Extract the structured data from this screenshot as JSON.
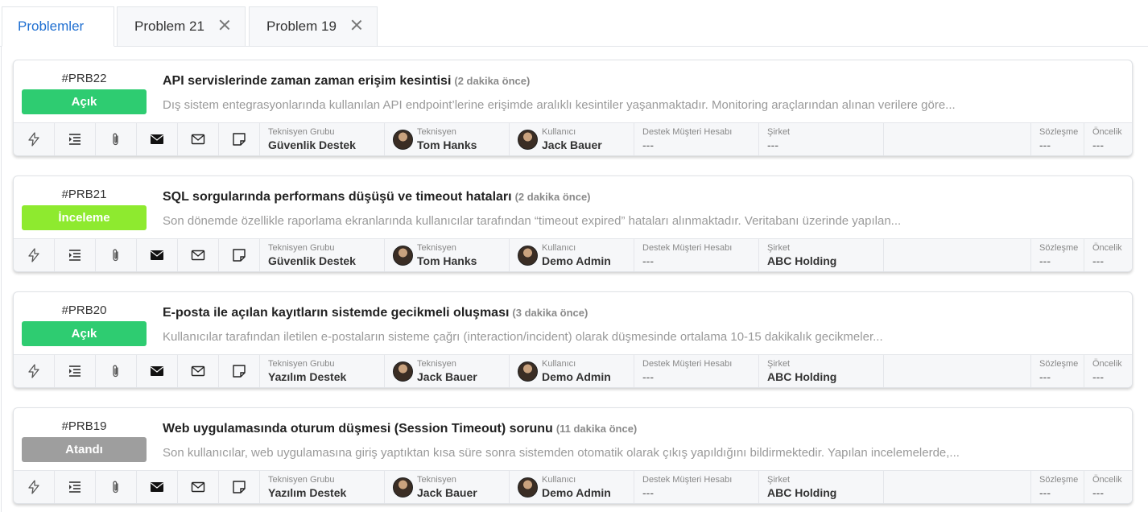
{
  "tabs": [
    {
      "label": "Problemler"
    },
    {
      "label": "Problem 21"
    },
    {
      "label": "Problem 19"
    }
  ],
  "field_labels": {
    "tech_group": "Teknisyen Grubu",
    "technician": "Teknisyen",
    "user": "Kullanıcı",
    "customer_account": "Destek Müşteri Hesabı",
    "company": "Şirket",
    "contract": "Sözleşme",
    "priority": "Öncelik"
  },
  "status_colors": {
    "Açık": "#2ecc71",
    "İnceleme": "#8eea2f",
    "Atandı": "#9e9e9e"
  },
  "footer_icons": [
    "bolt-icon",
    "list-indent-icon",
    "paperclip-icon",
    "envelope-filled-icon",
    "envelope-outline-icon",
    "note-icon"
  ],
  "problems": [
    {
      "code": "#PRB22",
      "status": "Açık",
      "title": "API servislerinde zaman zaman erişim kesintisi",
      "ago": "(2 dakika önce)",
      "description": "Dış sistem entegrasyonlarında kullanılan API endpoint’lerine erişimde aralıklı kesintiler yaşanmaktadır. Monitoring araçlarından alınan verilere göre...",
      "tech_group": "Güvenlik Destek",
      "technician": "Tom Hanks",
      "user": "Jack Bauer",
      "customer_account": "---",
      "company": "---",
      "contract": "---",
      "priority": "---"
    },
    {
      "code": "#PRB21",
      "status": "İnceleme",
      "title": "SQL sorgularında performans düşüşü ve timeout hataları",
      "ago": "(2 dakika önce)",
      "description": "Son dönemde özellikle raporlama ekranlarında kullanıcılar tarafından “timeout expired” hataları alınmaktadır. Veritabanı üzerinde yapılan...",
      "tech_group": "Güvenlik Destek",
      "technician": "Tom Hanks",
      "user": "Demo Admin",
      "customer_account": "---",
      "company": "ABC Holding",
      "contract": "---",
      "priority": "---"
    },
    {
      "code": "#PRB20",
      "status": "Açık",
      "title": "E-posta ile açılan kayıtların sistemde gecikmeli oluşması",
      "ago": "(3 dakika önce)",
      "description": "Kullanıcılar tarafından iletilen e-postaların sisteme çağrı (interaction/incident) olarak düşmesinde ortalama 10-15 dakikalık gecikmeler...",
      "tech_group": "Yazılım Destek",
      "technician": "Jack Bauer",
      "user": "Demo Admin",
      "customer_account": "---",
      "company": "ABC Holding",
      "contract": "---",
      "priority": "---"
    },
    {
      "code": "#PRB19",
      "status": "Atandı",
      "title": "Web uygulamasında oturum düşmesi (Session Timeout) sorunu",
      "ago": "(11 dakika önce)",
      "description": "Son kullanıcılar, web uygulamasına giriş yaptıktan kısa süre sonra sistemden otomatik olarak çıkış yapıldığını bildirmektedir. Yapılan incelemelerde,...",
      "tech_group": "Yazılım Destek",
      "technician": "Jack Bauer",
      "user": "Demo Admin",
      "customer_account": "---",
      "company": "ABC Holding",
      "contract": "---",
      "priority": "---"
    }
  ]
}
